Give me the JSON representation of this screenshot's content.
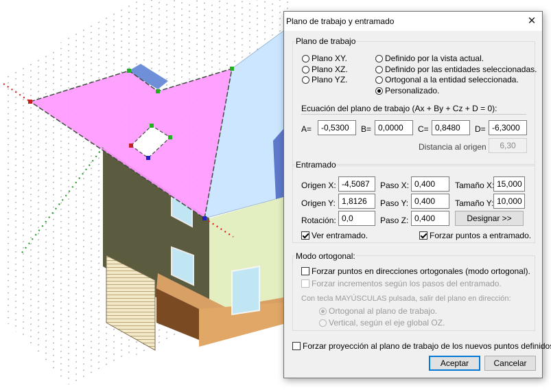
{
  "dialog": {
    "title": "Plano de trabajo y entramado",
    "close_glyph": "✕"
  },
  "work_plane": {
    "group_label": "Plano de trabajo",
    "options": [
      {
        "label": "Plano XY.",
        "selected": false
      },
      {
        "label": "Plano XZ.",
        "selected": false
      },
      {
        "label": "Plano YZ.",
        "selected": false
      },
      {
        "label": "Definido por la vista actual.",
        "selected": false
      },
      {
        "label": "Definido por las entidades seleccionadas.",
        "selected": false
      },
      {
        "label": "Ortogonal a la entidad seleccionada.",
        "selected": false
      },
      {
        "label": "Personalizado.",
        "selected": true
      }
    ],
    "equation_label": "Ecuación del plano de trabajo (Ax + By + Cz + D = 0):",
    "a_label": "A=",
    "a_value": "-0,5300",
    "b_label": "B=",
    "b_value": "0,0000",
    "c_label": "C=",
    "c_value": "0,8480",
    "d_label": "D=",
    "d_value": "-6,3000",
    "distance_label": "Distancia al origen =",
    "distance_value": "6,30"
  },
  "grid": {
    "group_label": "Entramado",
    "origin_x_label": "Origen X:",
    "origin_x_value": "-4,5087",
    "origin_y_label": "Origen Y:",
    "origin_y_value": "1,8126",
    "rotation_label": "Rotación:",
    "rotation_value": "0,0",
    "step_x_label": "Paso X:",
    "step_x_value": "0,400",
    "step_y_label": "Paso Y:",
    "step_y_value": "0,400",
    "step_z_label": "Paso Z:",
    "step_z_value": "0,400",
    "size_x_label": "Tamaño X:",
    "size_x_value": "15,000",
    "size_y_label": "Tamaño Y:",
    "size_y_value": "10,000",
    "assign_button": "Designar >>",
    "show_grid_label": "Ver entramado.",
    "show_grid_checked": true,
    "snap_grid_label": "Forzar puntos a entramado.",
    "snap_grid_checked": true
  },
  "ortho": {
    "group_label": "Modo ortogonal:",
    "force_ortho_label": "Forzar puntos en direcciones ortogonales (modo ortogonal).",
    "force_ortho_checked": false,
    "force_steps_label": "Forzar incrementos según los pasos del entramado.",
    "force_steps_checked": false,
    "shift_note": "Con tecla MAYÚSCULAS pulsada, salir del plano en dirección:",
    "ortho_plane_label": "Ortogonal al plano de trabajo.",
    "vertical_label": "Vertical, según el eje global OZ."
  },
  "footer": {
    "projection_label": "Forzar proyección al plano de trabajo de los nuevos puntos definidos.",
    "projection_checked": false,
    "ok_label": "Aceptar",
    "cancel_label": "Cancelar"
  },
  "colors": {
    "work_plane_fill": "#ff99ff",
    "roof_blue": "#cce6ff",
    "wall_dark": "#5b5b3f",
    "wall_light": "#e3efc1",
    "base_brown": "#d9a066",
    "accent": "#0078d7"
  }
}
